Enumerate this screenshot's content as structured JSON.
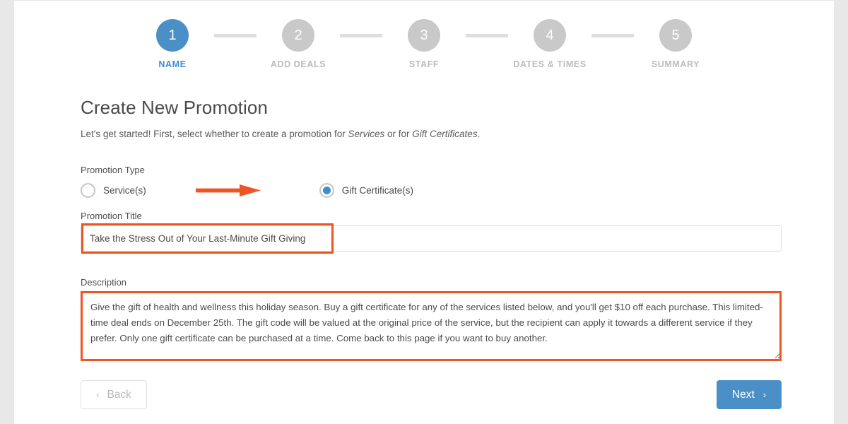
{
  "colors": {
    "accent_blue": "#4a90c7",
    "annotation_orange": "#ef5423",
    "inactive_gray": "#c9c9c9",
    "page_gutter": "#e8e8e8"
  },
  "stepper": {
    "steps": [
      {
        "number": "1",
        "label": "NAME",
        "state": "active"
      },
      {
        "number": "2",
        "label": "ADD DEALS",
        "state": "inactive"
      },
      {
        "number": "3",
        "label": "STAFF",
        "state": "inactive"
      },
      {
        "number": "4",
        "label": "DATES & TIMES",
        "state": "inactive"
      },
      {
        "number": "5",
        "label": "SUMMARY",
        "state": "inactive"
      }
    ]
  },
  "main": {
    "title": "Create New Promotion",
    "intro_before": "Let's get started! First, select whether to create a promotion for ",
    "intro_em1": "Services",
    "intro_mid": " or for ",
    "intro_em2": "Gift Certificates",
    "intro_after": ".",
    "promotion_type": {
      "label": "Promotion Type",
      "options": [
        {
          "label": "Service(s)",
          "selected": false
        },
        {
          "label": "Gift Certificate(s)",
          "selected": true
        }
      ]
    },
    "promotion_title": {
      "label": "Promotion Title",
      "value": "Take the Stress Out of Your Last-Minute Gift Giving",
      "placeholder": "Promotion Title"
    },
    "description": {
      "label": "Description",
      "value": "Give the gift of health and wellness this holiday season. Buy a gift certificate for any of the services listed below, and you'll get $10 off each purchase. This limited-time deal ends on December 25th. The gift code will be valued at the original price of the service, but the recipient can apply it towards a different service if they prefer. Only one gift certificate can be purchased at a time. Come back to this page if you want to buy another.",
      "placeholder": "Description"
    },
    "buttons": {
      "back": "Back",
      "next": "Next",
      "back_chevron": "‹",
      "next_chevron": "›"
    }
  }
}
